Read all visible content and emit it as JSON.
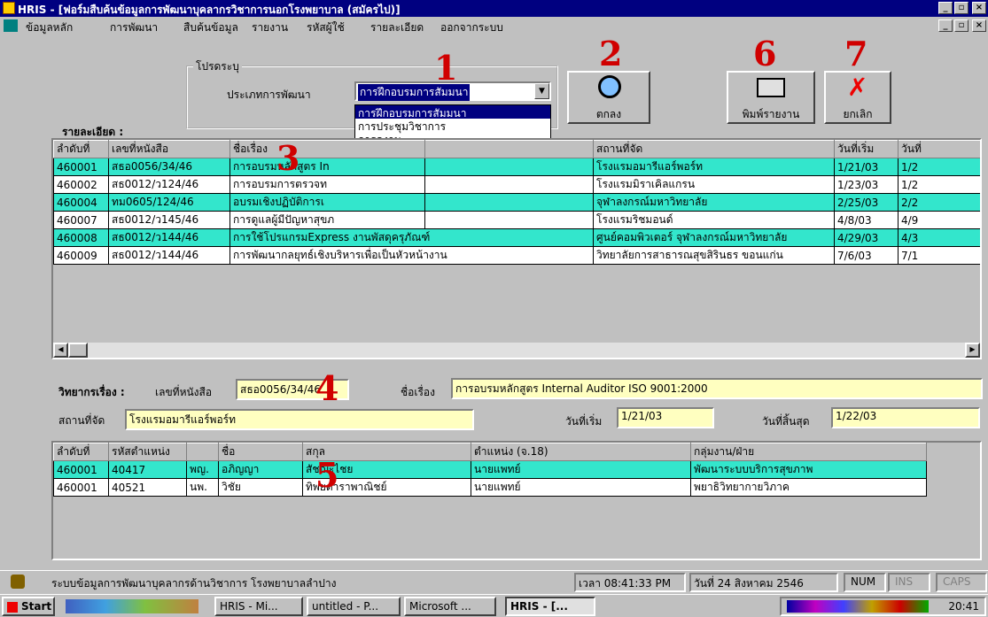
{
  "window": {
    "title": "HRIS - [ฟอร์มสืบค้นข้อมูลการพัฒนาบุคลากรวิชาการนอกโรงพยาบาล (สมัครไป)]"
  },
  "menu": [
    "ข้อมูลหลัก",
    "การพัฒนา",
    "สืบค้นข้อมูล",
    "รายงาน",
    "รหัสผู้ใช้",
    "รายละเอียด",
    "ออกจากระบบ"
  ],
  "filter": {
    "group_label": "โปรดระบุ",
    "type_label": "ประเภทการพัฒนา",
    "selected": "การฝึกอบรมการสัมมนา",
    "options": [
      "การฝึกอบรมการสัมมนา",
      "การประชุมวิชาการ",
      "การดูงาน"
    ]
  },
  "buttons": {
    "ok": "ตกลง",
    "print": "พิมพ์รายงาน",
    "cancel": "ยกเลิก"
  },
  "annotations": [
    "1",
    "2",
    "3",
    "4",
    "5",
    "6",
    "7"
  ],
  "details": {
    "label": "รายละเอียด :",
    "columns": [
      "ลำดับที่",
      "เลขที่หนังสือ",
      "ชื่อเรื่อง",
      "",
      "สถานที่จัด",
      "วันที่เริ่ม",
      "วันที่"
    ],
    "rows": [
      {
        "no": "460001",
        "doc": "สธอ0056/34/46",
        "title": "การอบรมหลักสูตร In",
        "place": "โรงแรมอมารีแอร์พอร์ท",
        "start": "1/21/03",
        "end": "1/2"
      },
      {
        "no": "460002",
        "doc": "สธ0012/ว124/46",
        "title": "การอบรมการตรวจท",
        "place": "โรงแรมมิราเคิลแกรน",
        "start": "1/23/03",
        "end": "1/2"
      },
      {
        "no": "460004",
        "doc": "ทม0605/124/46",
        "title": "อบรมเชิงปฏิบัติการเ",
        "place": "จุฬาลงกรณ์มหาวิทยาลัย",
        "start": "2/25/03",
        "end": "2/2"
      },
      {
        "no": "460007",
        "doc": "สธ0012/ว145/46",
        "title": "การดูแลผู้มีปัญหาสุขภ",
        "place": "โรงแรมริชมอนด์",
        "start": "4/8/03",
        "end": "4/9"
      },
      {
        "no": "460008",
        "doc": "สธ0012/ว144/46",
        "title": "การใช้โปรแกรมExpress งานพัสดุครุภัณฑ์",
        "place": "ศูนย์คอมพิวเตอร์ จุฬาลงกรณ์มหาวิทยาลัย",
        "start": "4/29/03",
        "end": "4/3"
      },
      {
        "no": "460009",
        "doc": "สธ0012/ว144/46",
        "title": "การพัฒนากลยุทธ์เชิงบริหารเพื่อเป็นหัวหน้างาน",
        "place": "วิทยาลัยการสาธารณสุขสิรินธร ขอนแก่น",
        "start": "7/6/03",
        "end": "7/1"
      }
    ]
  },
  "form": {
    "section_label": "วิทยากรเรื่อง :",
    "doc_label": "เลขที่หนังสือ",
    "doc_value": "สธอ0056/34/46",
    "title_label": "ชื่อเรื่อง",
    "title_value": "การอบรมหลักสูตร Internal Auditor ISO 9001:2000",
    "place_label": "สถานที่จัด",
    "place_value": "โรงแรมอมารีแอร์พอร์ท",
    "start_label": "วันที่เริ่ม",
    "start_value": "1/21/03",
    "end_label": "วันที่สิ้นสุด",
    "end_value": "1/22/03"
  },
  "speakers": {
    "columns": [
      "ลำดับที่",
      "รหัสตำแหน่ง",
      "",
      "ชื่อ",
      "สกุล",
      "ตำแหน่ง (จ.18)",
      "กลุ่มงาน/ฝ่าย"
    ],
    "rows": [
      {
        "no": "460001",
        "pos": "40417",
        "pre": "พญ.",
        "name": "อภิญญา",
        "sur": "สัชฌะไชย",
        "title": "นายแพทย์",
        "dept": "พัฒนาระบบบริการสุขภาพ"
      },
      {
        "no": "460001",
        "pos": "40521",
        "pre": "นพ.",
        "name": "วิชัย",
        "sur": "ทิพยดาราพาณิชย์",
        "title": "นายแพทย์",
        "dept": "พยาธิวิทยากายวิภาค"
      }
    ]
  },
  "status": {
    "text": "ระบบข้อมูลการพัฒนาบุคลากรด้านวิชาการ โรงพยาบาลลำปาง",
    "time": "เวลา 08:41:33 PM",
    "date": "วันที่ 24 สิงหาคม 2546",
    "num": "NUM",
    "ins": "INS",
    "caps": "CAPS"
  },
  "taskbar": {
    "start": "Start",
    "items": [
      "HRIS - Mi...",
      "untitled - P...",
      "Microsoft ...",
      "HRIS - [..."
    ],
    "clock": "20:41"
  }
}
